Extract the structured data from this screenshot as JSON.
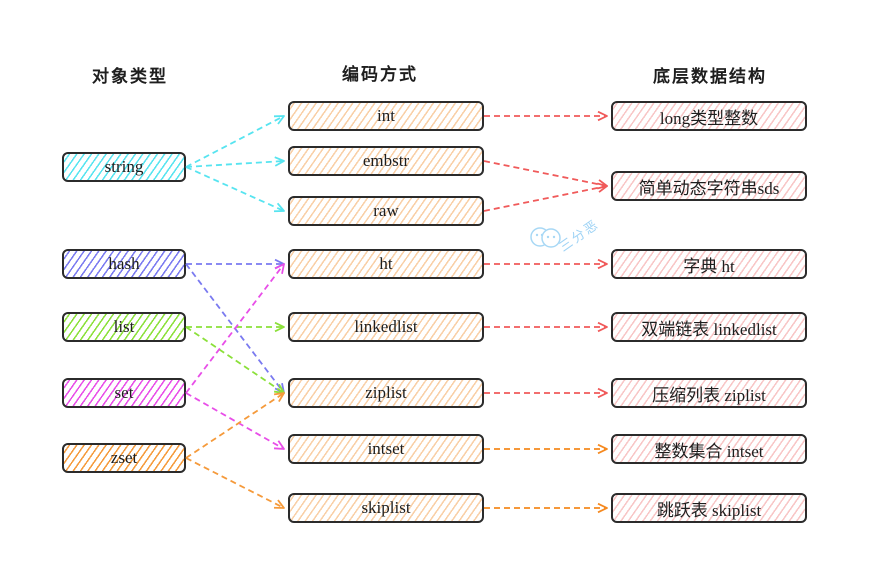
{
  "titles": {
    "object_type": "对象类型",
    "encoding": "编码方式",
    "structure": "底层数据结构"
  },
  "colors": {
    "string": "#57e4f0",
    "hash": "#7a7af0",
    "list": "#8be03a",
    "set": "#e84ee8",
    "zset": "#f59a3b",
    "encoding_fill": "#f8c89a",
    "structure_fill": "#f7b8b8",
    "arrow_red": "#f05a5a",
    "arrow_orange": "#f5891f"
  },
  "object_types": [
    {
      "id": "string",
      "label": "string"
    },
    {
      "id": "hash",
      "label": "hash"
    },
    {
      "id": "list",
      "label": "list"
    },
    {
      "id": "set",
      "label": "set"
    },
    {
      "id": "zset",
      "label": "zset"
    }
  ],
  "encodings": [
    {
      "id": "int",
      "label": "int"
    },
    {
      "id": "embstr",
      "label": "embstr"
    },
    {
      "id": "raw",
      "label": "raw"
    },
    {
      "id": "ht",
      "label": "ht"
    },
    {
      "id": "linkedlist",
      "label": "linkedlist"
    },
    {
      "id": "ziplist",
      "label": "ziplist"
    },
    {
      "id": "intset",
      "label": "intset"
    },
    {
      "id": "skiplist",
      "label": "skiplist"
    }
  ],
  "structures": [
    {
      "id": "long",
      "label": "long类型整数"
    },
    {
      "id": "sds",
      "label": "简单动态字符串sds"
    },
    {
      "id": "dict",
      "label": "字典 ht"
    },
    {
      "id": "dlist",
      "label": "双端链表 linkedlist"
    },
    {
      "id": "zlist",
      "label": "压缩列表 ziplist"
    },
    {
      "id": "iset",
      "label": "整数集合 intset"
    },
    {
      "id": "slist",
      "label": "跳跃表 skiplist"
    }
  ],
  "edges": [
    {
      "from": "string",
      "to": "int",
      "color": "string"
    },
    {
      "from": "string",
      "to": "embstr",
      "color": "string"
    },
    {
      "from": "string",
      "to": "raw",
      "color": "string"
    },
    {
      "from": "hash",
      "to": "ht",
      "color": "hash"
    },
    {
      "from": "hash",
      "to": "ziplist",
      "color": "hash"
    },
    {
      "from": "list",
      "to": "linkedlist",
      "color": "list"
    },
    {
      "from": "list",
      "to": "ziplist",
      "color": "list"
    },
    {
      "from": "set",
      "to": "ht",
      "color": "set"
    },
    {
      "from": "set",
      "to": "intset",
      "color": "set"
    },
    {
      "from": "zset",
      "to": "ziplist",
      "color": "zset"
    },
    {
      "from": "zset",
      "to": "skiplist",
      "color": "zset"
    },
    {
      "from": "int",
      "to": "long",
      "color": "arrow_red"
    },
    {
      "from": "embstr",
      "to": "sds",
      "color": "arrow_red"
    },
    {
      "from": "raw",
      "to": "sds",
      "color": "arrow_red"
    },
    {
      "from": "ht",
      "to": "dict",
      "color": "arrow_red"
    },
    {
      "from": "linkedlist",
      "to": "dlist",
      "color": "arrow_red"
    },
    {
      "from": "ziplist",
      "to": "zlist",
      "color": "arrow_red"
    },
    {
      "from": "intset",
      "to": "iset",
      "color": "arrow_orange"
    },
    {
      "from": "skiplist",
      "to": "slist",
      "color": "arrow_orange"
    }
  ],
  "watermark": "三分恶"
}
